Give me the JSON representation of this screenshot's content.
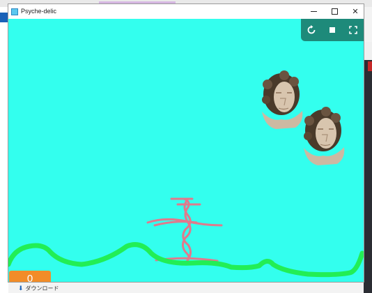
{
  "window": {
    "title": "Psyche-delic"
  },
  "toolbar": {
    "icons": [
      "restart-icon",
      "stop-icon",
      "fullscreen-icon"
    ]
  },
  "game": {
    "score": "0",
    "sprites": [
      "statue-head",
      "statue-head",
      "stick-figure",
      "green-ground-line"
    ]
  },
  "background": {
    "download_label": "ダウンロード"
  },
  "colors": {
    "canvas": "#33ffee",
    "ground": "#22ee55",
    "figure": "#e07a8c",
    "score_bg": "#f28c28",
    "toolbar_bg": "#1e8a7a"
  }
}
